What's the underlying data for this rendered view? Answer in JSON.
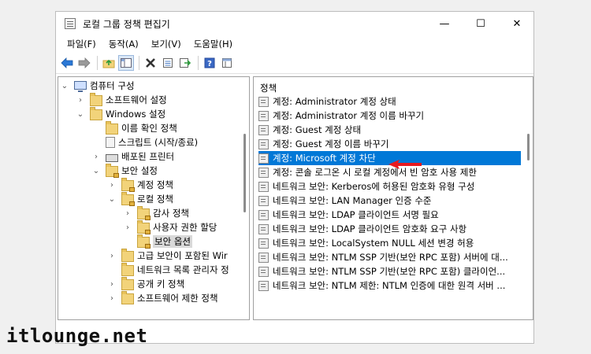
{
  "window": {
    "title": "로컬 그룹 정책 편집기",
    "controls": {
      "minimize": "—",
      "maximize": "☐",
      "close": "✕"
    }
  },
  "menu": [
    "파일(F)",
    "동작(A)",
    "보기(V)",
    "도움말(H)"
  ],
  "toolbar": [
    "back-icon",
    "forward-icon",
    "up-folder-icon",
    "show-hide-tree-icon",
    "delete-icon",
    "properties-icon",
    "export-icon",
    "help-icon",
    "view-icon"
  ],
  "tree": {
    "items": [
      {
        "label": "컴퓨터 구성",
        "expander": "⌄",
        "icon": "computer-icon"
      },
      {
        "label": "소프트웨어 설정",
        "expander": "›",
        "icon": "folder-icon"
      },
      {
        "label": "Windows 설정",
        "expander": "⌄",
        "icon": "folder-icon"
      },
      {
        "label": "이름 확인 정책",
        "expander": "",
        "icon": "folder-icon"
      },
      {
        "label": "스크립트 (시작/종료)",
        "expander": "",
        "icon": "script-icon"
      },
      {
        "label": "배포된 프린터",
        "expander": "›",
        "icon": "printer-icon"
      },
      {
        "label": "보안 설정",
        "expander": "⌄",
        "icon": "folder-lock-icon"
      },
      {
        "label": "계정 정책",
        "expander": "›",
        "icon": "folder-lock-icon"
      },
      {
        "label": "로컬 정책",
        "expander": "⌄",
        "icon": "folder-lock-icon"
      },
      {
        "label": "감사 정책",
        "expander": "›",
        "icon": "folder-lock-icon"
      },
      {
        "label": "사용자 권한 할당",
        "expander": "›",
        "icon": "folder-lock-icon"
      },
      {
        "label": "보안 옵션",
        "expander": "",
        "icon": "folder-lock-icon"
      },
      {
        "label": "고급 보안이 포함된 Wir",
        "expander": "›",
        "icon": "folder-icon"
      },
      {
        "label": "네트워크 목록 관리자 정",
        "expander": "",
        "icon": "folder-icon"
      },
      {
        "label": "공개 키 정책",
        "expander": "›",
        "icon": "folder-icon"
      },
      {
        "label": "소프트웨어 제한 정책",
        "expander": "›",
        "icon": "folder-icon"
      }
    ],
    "selected_index": 11
  },
  "list": {
    "header": "정책",
    "sort_indicator": "^",
    "selected_index": 4,
    "items": [
      "계정: Administrator 계정 상태",
      "계정: Administrator 계정 이름 바꾸기",
      "계정: Guest 계정 상태",
      "계정: Guest 계정 이름 바꾸기",
      "계정: Microsoft 계정 차단",
      "계정: 콘솔 로그온 시 로컬 계정에서 빈 암호 사용 제한",
      "네트워크 보안: Kerberos에 허용된 암호화 유형 구성",
      "네트워크 보안: LAN Manager 인증 수준",
      "네트워크 보안: LDAP 클라이언트 서명 필요",
      "네트워크 보안: LDAP 클라이언트 암호화 요구 사항",
      "네트워크 보안: LocalSystem NULL 세션 변경 허용",
      "네트워크 보안: NTLM SSP 기반(보안 RPC 포함) 서버에 대...",
      "네트워크 보안: NTLM SSP 기반(보안 RPC 포함) 클라이언...",
      "네트워크 보안: NTLM 제한: NTLM 인증에 대한 원격 서버 ..."
    ]
  },
  "colors": {
    "selection": "#0078d7",
    "arrow": "#e8191f"
  },
  "watermark": "itlounge.net"
}
